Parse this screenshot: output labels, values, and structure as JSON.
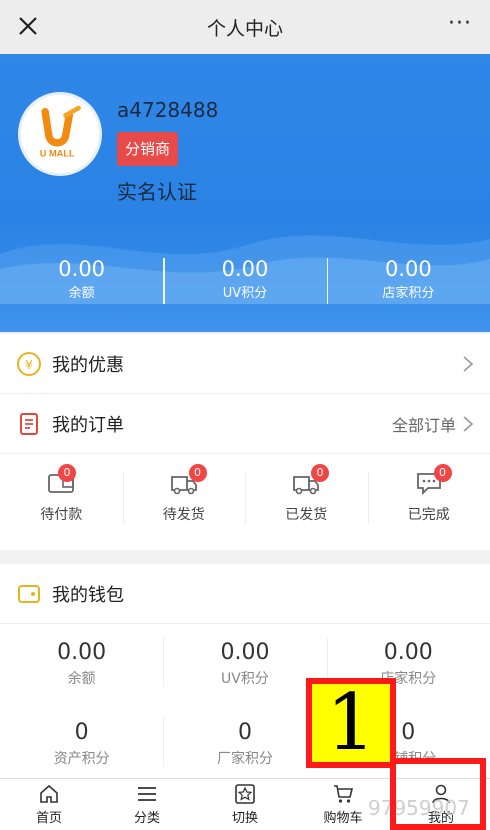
{
  "topbar": {
    "title": "个人中心",
    "more": "···"
  },
  "profile": {
    "logo_text": "U MALL",
    "username": "a4728488",
    "role_badge": "分销商",
    "verify": "实名认证"
  },
  "stats": [
    {
      "value": "0.00",
      "label": "余额"
    },
    {
      "value": "0.00",
      "label": "UV积分"
    },
    {
      "value": "0.00",
      "label": "店家积分"
    }
  ],
  "menu": {
    "coupons": "我的优惠",
    "orders": "我的订单",
    "all_orders": "全部订单"
  },
  "order_status": [
    {
      "label": "待付款",
      "count": "0"
    },
    {
      "label": "待发货",
      "count": "0"
    },
    {
      "label": "已发货",
      "count": "0"
    },
    {
      "label": "已完成",
      "count": "0"
    }
  ],
  "wallet": {
    "title": "我的钱包",
    "items": [
      {
        "value": "0.00",
        "label": "余额"
      },
      {
        "value": "0.00",
        "label": "UV积分"
      },
      {
        "value": "0.00",
        "label": "店家积分"
      },
      {
        "value": "0",
        "label": "资产积分"
      },
      {
        "value": "0",
        "label": "厂家积分"
      },
      {
        "value": "0",
        "label": "店铺积分"
      }
    ],
    "partial_value": "0",
    "watermark": "97959907"
  },
  "tabbar": [
    {
      "label": "首页",
      "icon": "home-icon"
    },
    {
      "label": "分类",
      "icon": "menu-icon"
    },
    {
      "label": "切换",
      "icon": "switch-icon"
    },
    {
      "label": "购物车",
      "icon": "cart-icon"
    },
    {
      "label": "我的",
      "icon": "user-icon"
    }
  ],
  "annotation": {
    "number": "1"
  },
  "colors": {
    "hero": "#2f87e8",
    "badge": "#e84a4a",
    "annotation_border": "#ff1a1a",
    "annotation_fill": "#ffff00"
  }
}
